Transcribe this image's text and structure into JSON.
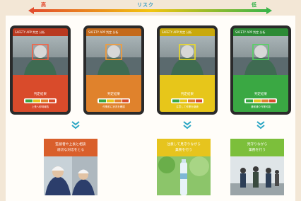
{
  "risk_scale": {
    "high_label": "高",
    "title": "リスク",
    "low_label": "低",
    "colors": {
      "high": "#e24a2e",
      "mid": "#f2c40f",
      "low": "#35b34a"
    }
  },
  "tablets": [
    {
      "header": "SAFETY APP  判定  分析",
      "result_title": "判定結果",
      "note": "上長へ即時報告",
      "color": "#d94b2b",
      "level": "high"
    },
    {
      "header": "SAFETY APP  判定  分析",
      "result_title": "判定結果",
      "note": "作業前に状況を確認",
      "color": "#e0822c",
      "level": "mid-high"
    },
    {
      "header": "SAFETY APP  判定  分析",
      "result_title": "判定結果",
      "note": "注意して作業を継続",
      "color": "#e7c61a",
      "level": "mid-low"
    },
    {
      "header": "SAFETY APP  判定  分析",
      "result_title": "判定結果",
      "note": "通常通り作業可能",
      "color": "#3aa843",
      "level": "low"
    }
  ],
  "outcomes": [
    {
      "text": "監督者や上長と相談\n適切な対応をとる",
      "color": "#d95f2b"
    },
    {
      "text": "注意して見守りながら\n業務を行う",
      "color": "#e6c41e"
    },
    {
      "text": "見守りながら\n業務を行う",
      "color": "#7cbf3b"
    }
  ]
}
